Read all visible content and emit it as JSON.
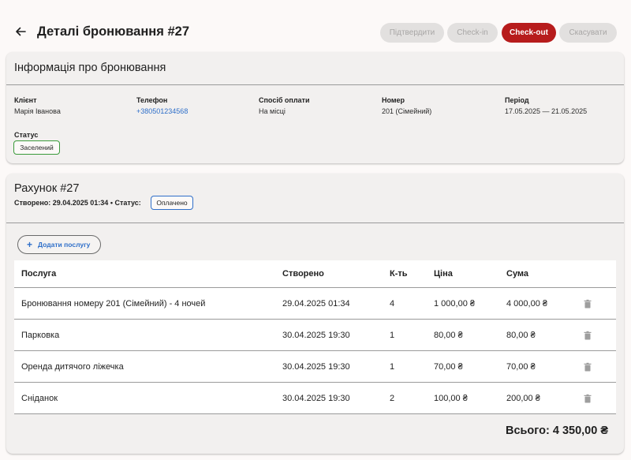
{
  "header": {
    "title": "Деталі бронювання #27",
    "buttons": {
      "confirm": "Підтвердити",
      "checkin": "Check-in",
      "checkout": "Check-out",
      "cancel": "Скасувати"
    }
  },
  "booking_info": {
    "title": "Інформація про бронювання",
    "fields": {
      "client": {
        "label": "Клієнт",
        "value": "Марія Іванова"
      },
      "phone": {
        "label": "Телефон",
        "value": "+380501234568"
      },
      "payment": {
        "label": "Спосіб оплати",
        "value": "На місці"
      },
      "room": {
        "label": "Номер",
        "value": "201 (Сімейний)"
      },
      "period": {
        "label": "Період",
        "value": "17.05.2025 — 21.05.2025"
      },
      "status": {
        "label": "Статус",
        "value": "Заселений"
      }
    }
  },
  "invoice": {
    "title": "Рахунок #27",
    "created_line": "Створено: 29.04.2025 01:34 • Статус:",
    "status": "Оплачено",
    "add_service": "Додати послугу",
    "columns": [
      "Послуга",
      "Створено",
      "К-ть",
      "Ціна",
      "Сума"
    ],
    "rows": [
      [
        "Бронювання номеру 201 (Сімейний) - 4 ночей",
        "29.04.2025 01:34",
        "4",
        "1 000,00 ₴",
        "4 000,00 ₴"
      ],
      [
        "Парковка",
        "30.04.2025 19:30",
        "1",
        "80,00 ₴",
        "80,00 ₴"
      ],
      [
        "Оренда дитячого ліжечка",
        "30.04.2025 19:30",
        "1",
        "70,00 ₴",
        "70,00 ₴"
      ],
      [
        "Сніданок",
        "30.04.2025 19:30",
        "2",
        "100,00 ₴",
        "200,00 ₴"
      ]
    ],
    "total": "Всього: 4 350,00 ₴"
  },
  "colors": {
    "accent_red": "#b71c1c",
    "link_blue": "#2f6fc9",
    "status_green": "#3b9a3b"
  },
  "icons": [
    "arrow-back-icon",
    "plus-icon",
    "trash-icon"
  ]
}
